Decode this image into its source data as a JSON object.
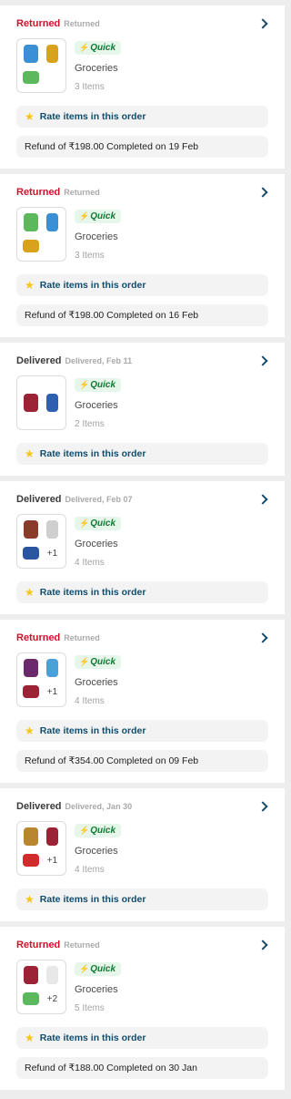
{
  "colors": {
    "returned": "#d0112b",
    "delivered": "#3a3a3a",
    "accent": "#0f4d6e",
    "quick_badge_bg": "#e6f6ea",
    "quick_badge_text": "#0d7a32",
    "star": "#f5c518"
  },
  "icons": {
    "chevron": "chevron-right-icon",
    "star": "star-icon",
    "quick": "lightning-icon"
  },
  "orders": [
    {
      "status": "Returned",
      "status_type": "returned",
      "sub_status": "Returned",
      "badge": "Quick",
      "category": "Groceries",
      "items_count": "3 Items",
      "rate_label": "Rate items in this order",
      "refund": "Refund of ₹198.00 Completed on 19 Feb",
      "thumbs": [
        {
          "kind": "product",
          "color": "#3b8fd4"
        },
        {
          "kind": "product",
          "color": "#d9a21c"
        },
        {
          "kind": "product",
          "color": "#5cb85c"
        }
      ],
      "more": ""
    },
    {
      "status": "Returned",
      "status_type": "returned",
      "sub_status": "Returned",
      "badge": "Quick",
      "category": "Groceries",
      "items_count": "3 Items",
      "rate_label": "Rate items in this order",
      "refund": "Refund of ₹198.00 Completed on 16 Feb",
      "thumbs": [
        {
          "kind": "product",
          "color": "#5cb85c"
        },
        {
          "kind": "product",
          "color": "#3b8fd4"
        },
        {
          "kind": "product",
          "color": "#d9a21c"
        }
      ],
      "more": ""
    },
    {
      "status": "Delivered",
      "status_type": "delivered",
      "sub_status": "Delivered, Feb 11",
      "badge": "Quick",
      "category": "Groceries",
      "items_count": "2 Items",
      "rate_label": "Rate items in this order",
      "refund": "",
      "thumbs": [
        {
          "kind": "product",
          "color": "#9b2335"
        },
        {
          "kind": "product",
          "color": "#2f5fb0"
        }
      ],
      "more": ""
    },
    {
      "status": "Delivered",
      "status_type": "delivered",
      "sub_status": "Delivered, Feb 07",
      "badge": "Quick",
      "category": "Groceries",
      "items_count": "4 Items",
      "rate_label": "Rate items in this order",
      "refund": "",
      "thumbs": [
        {
          "kind": "product",
          "color": "#8a3b2a"
        },
        {
          "kind": "product",
          "color": "#cfcfcf"
        },
        {
          "kind": "product",
          "color": "#2a55a0"
        }
      ],
      "more": "+1"
    },
    {
      "status": "Returned",
      "status_type": "returned",
      "sub_status": "Returned",
      "badge": "Quick",
      "category": "Groceries",
      "items_count": "4 Items",
      "rate_label": "Rate items in this order",
      "refund": "Refund of ₹354.00 Completed on 09 Feb",
      "thumbs": [
        {
          "kind": "product",
          "color": "#6b2a6b"
        },
        {
          "kind": "product",
          "color": "#4aa0d8"
        },
        {
          "kind": "product",
          "color": "#9b2335"
        }
      ],
      "more": "+1"
    },
    {
      "status": "Delivered",
      "status_type": "delivered",
      "sub_status": "Delivered, Jan 30",
      "badge": "Quick",
      "category": "Groceries",
      "items_count": "4 Items",
      "rate_label": "Rate items in this order",
      "refund": "",
      "thumbs": [
        {
          "kind": "product",
          "color": "#b8862f"
        },
        {
          "kind": "product",
          "color": "#9b2335"
        },
        {
          "kind": "product",
          "color": "#d22b2b"
        }
      ],
      "more": "+1"
    },
    {
      "status": "Returned",
      "status_type": "returned",
      "sub_status": "Returned",
      "badge": "Quick",
      "category": "Groceries",
      "items_count": "5 Items",
      "rate_label": "Rate items in this order",
      "refund": "Refund of ₹188.00 Completed on 30 Jan",
      "thumbs": [
        {
          "kind": "product",
          "color": "#9b2335"
        },
        {
          "kind": "product",
          "color": "#e8e8e8"
        },
        {
          "kind": "product",
          "color": "#5cb85c"
        }
      ],
      "more": "+2"
    }
  ]
}
